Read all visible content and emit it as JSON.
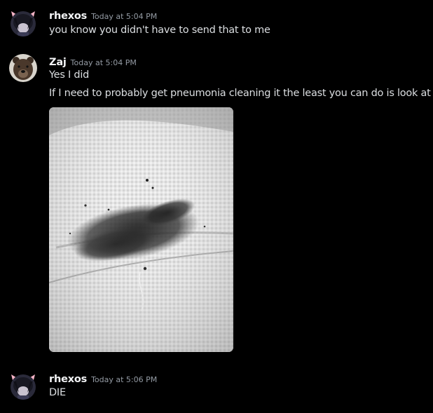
{
  "messages": [
    {
      "username": "rhexos",
      "timestamp": "Today at 5:04 PM",
      "avatar_icon": "cat-ear-anime-avatar-icon",
      "lines": [
        "you know you didn't have to send that to me"
      ]
    },
    {
      "username": "Zaj",
      "timestamp": "Today at 5:04 PM",
      "avatar_icon": "bear-avatar-icon",
      "lines": [
        "Yes I did",
        "If I need to probably get pneumonia cleaning it the least you can do is look at jt"
      ],
      "attachment": {
        "type": "image",
        "icon": "paper-towel-with-dark-stain-photo"
      }
    },
    {
      "username": "rhexos",
      "timestamp": "Today at 5:06 PM",
      "avatar_icon": "cat-ear-anime-avatar-icon",
      "lines": [
        "DIE"
      ]
    }
  ],
  "colors": {
    "background": "#000000",
    "username": "#f2f3f5",
    "timestamp": "#949ba4",
    "text": "#dbdee1",
    "avatar_ears": "#f4b3c6"
  }
}
